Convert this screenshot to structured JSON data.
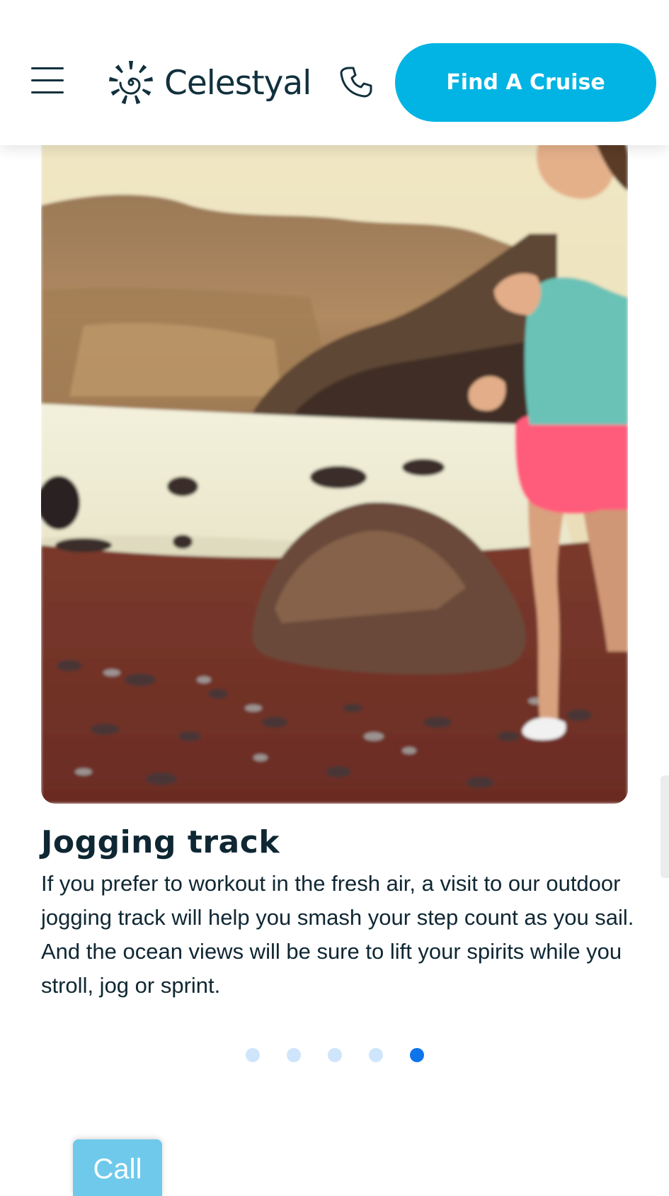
{
  "header": {
    "brand": "Celestyal",
    "cta_label": "Find A Cruise",
    "icons": {
      "menu": "hamburger-menu-icon",
      "logo": "celestyal-sun-logo-icon",
      "phone": "phone-icon"
    }
  },
  "slide": {
    "image_subject": "woman jogging on a red pebble beach by the sea",
    "title": "Jogging track",
    "description": "If you prefer to workout in the fresh air, a visit to our outdoor jogging track will help you smash your step count as you sail. And the ocean views will be sure to lift your spirits while you stroll, jog or sprint."
  },
  "carousel": {
    "total_slides": 5,
    "active_slide": 5
  },
  "call_button": {
    "label": "Call"
  },
  "colors": {
    "accent": "#01b4e3",
    "text": "#0f2733",
    "dot_active": "#0d74ea",
    "dot_inactive": "#cfe5fb",
    "call_button": "#6fc9ea"
  }
}
